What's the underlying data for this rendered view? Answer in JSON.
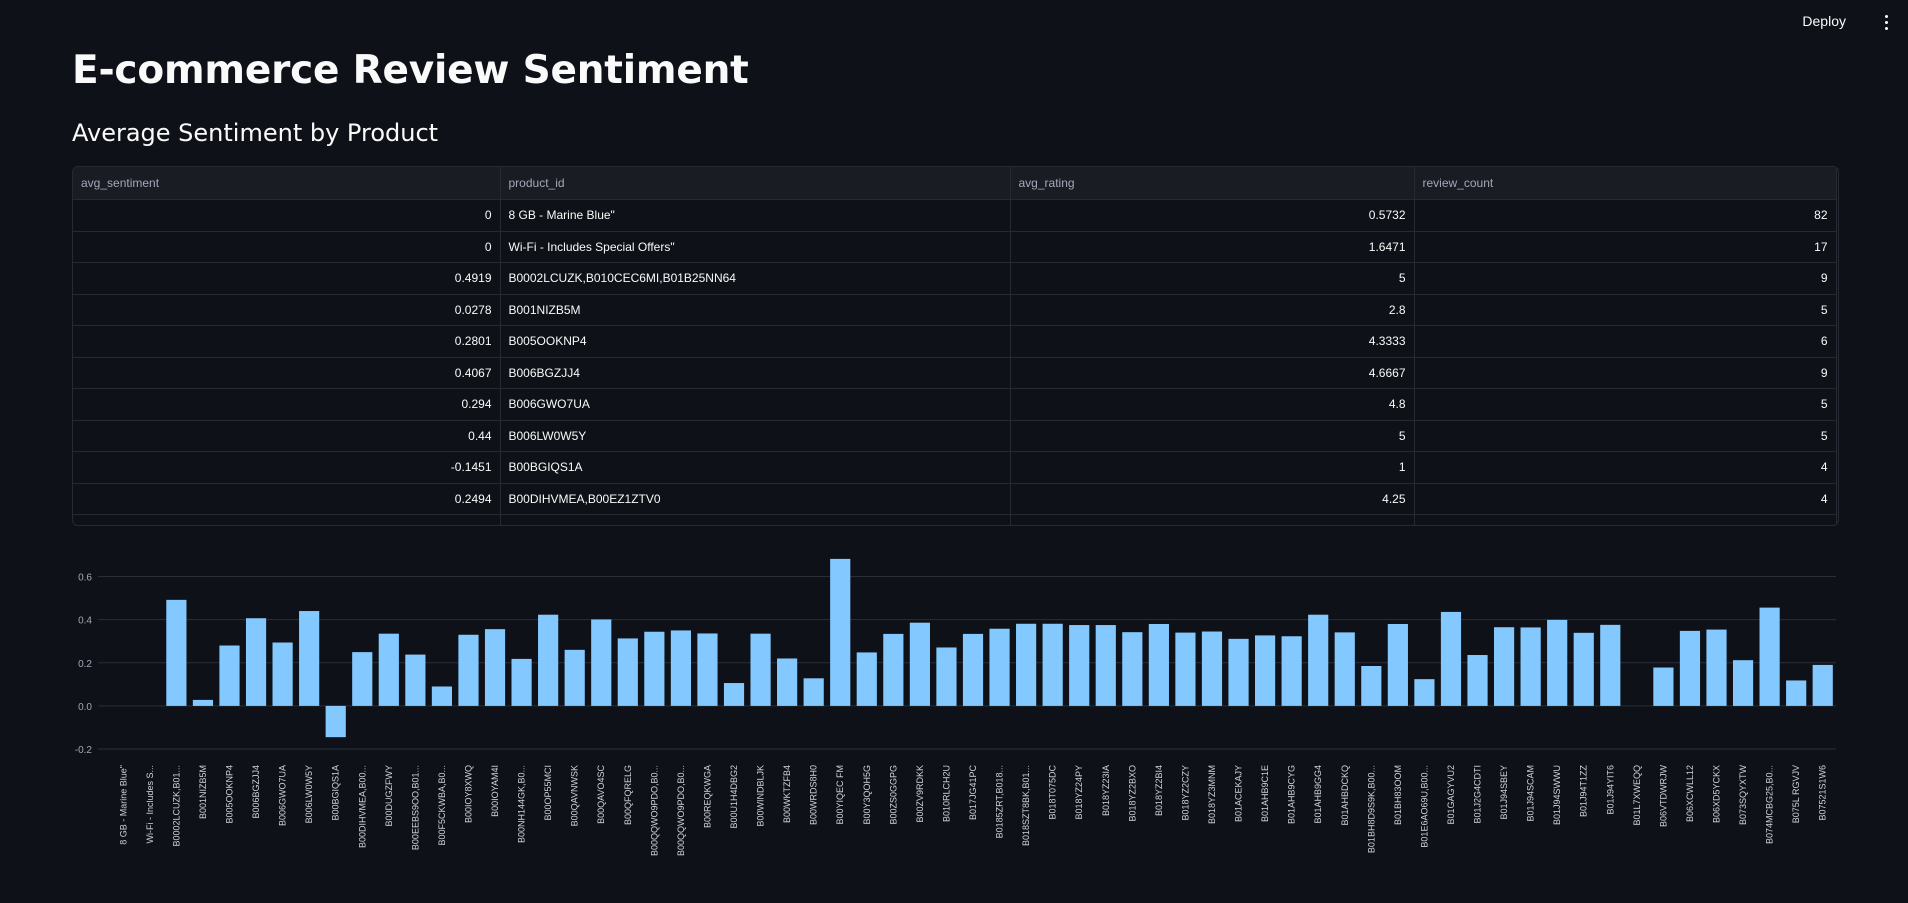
{
  "header": {
    "deploy_label": "Deploy"
  },
  "page": {
    "title": "E-commerce Review Sentiment",
    "section_title": "Average Sentiment by Product"
  },
  "table": {
    "columns": [
      "avg_sentiment",
      "product_id",
      "avg_rating",
      "review_count"
    ],
    "rows": [
      [
        "0",
        " 8 GB - Marine Blue\"",
        "0.5732",
        "82"
      ],
      [
        "0",
        " Wi-Fi - Includes Special Offers\"",
        "1.6471",
        "17"
      ],
      [
        "0.4919",
        "B0002LCUZK,B010CEC6MI,B01B25NN64",
        "5",
        "9"
      ],
      [
        "0.0278",
        "B001NIZB5M",
        "2.8",
        "5"
      ],
      [
        "0.2801",
        "B005OOKNP4",
        "4.3333",
        "6"
      ],
      [
        "0.4067",
        "B006BGZJJ4",
        "4.6667",
        "9"
      ],
      [
        "0.294",
        "B006GWO7UA",
        "4.8",
        "5"
      ],
      [
        "0.44",
        "B006LW0W5Y",
        "5",
        "5"
      ],
      [
        "-0.1451",
        "B00BGIQS1A",
        "1",
        "4"
      ],
      [
        "0.2494",
        "B00DIHVMEA,B00EZ1ZTV0",
        "4.25",
        "4"
      ]
    ]
  },
  "colors": {
    "bar": "#83c9ff",
    "grid": "#2a2e38",
    "axis_text": "#a3a8b8"
  },
  "chart_data": {
    "type": "bar",
    "ylim": [
      -0.2,
      0.7
    ],
    "yticks": [
      -0.2,
      0.0,
      0.2,
      0.4,
      0.6
    ],
    "grid": true,
    "xlabel": "",
    "ylabel": "",
    "categories": [
      "8 GB - Marine Blue\"",
      "Wi-Fi - Includes S...",
      "B0002LCUZK,B01...",
      "B001NIZB5M",
      "B005OOKNP4",
      "B006BGZJJ4",
      "B006GWO7UA",
      "B006LW0W5Y",
      "B00BGIQS1A",
      "B00DIHVMEA,B00...",
      "B00DUGZFWY",
      "B00EEBS9OO,B01...",
      "B00F5CKWBA,B0...",
      "B00IOY8XWQ",
      "B00IOYAM4I",
      "B00NH144GK,B0...",
      "B00OP55MCI",
      "B00QAVNWSK",
      "B00QAVO4SC",
      "B00QFQRELG",
      "B00QQWO9PDO,B0...",
      "B00QQWO9PDO,B0...",
      "B00REQKWGA",
      "B00U1H4DBG2",
      "B00WINDBLJK",
      "B00WKTZFB4",
      "B00WRDS8H0",
      "B00YIQEC FM",
      "B00Y3QOH5G",
      "B00ZS0GGPG",
      "B00ZV9RDKK",
      "B010RLCH2U",
      "B017JG41PC",
      "B0185ZRT,B018...",
      "B018SZT8BK,B01...",
      "B018T075DC",
      "B018YZ24PY",
      "B018YZ23IA",
      "B018YZ2BXO",
      "B018YZ2BI4",
      "B018YZ2CZY",
      "B018YZ3MNM",
      "B01ACEKAJY",
      "B01AHB9C1E",
      "B01AHB9CYG",
      "B01AHB9GG4",
      "B01AHBDCKQ",
      "B01BH8D9S9K,B00...",
      "B01BH83OOM",
      "B01E6AO69U,B00...",
      "B01GAGYVU2",
      "B01J2G4CDTI",
      "B01J94SBEY",
      "B01J94SCAM",
      "B01J94SWWU",
      "B01J94T1ZZ",
      "B01J94YIT6",
      "B01L7XWEQQ",
      "B06VTDWRJW",
      "B06XCWLL12",
      "B06XD5YCKX",
      "B073SQYXTW",
      "B074MCBG25,B0...",
      "B075L RGVJV",
      "B07521S1W6"
    ],
    "values": [
      0.0,
      0.0,
      0.4919,
      0.0278,
      0.2801,
      0.4067,
      0.294,
      0.44,
      -0.1451,
      0.2494,
      0.335,
      0.238,
      0.09,
      0.33,
      0.356,
      0.218,
      0.423,
      0.26,
      0.401,
      0.313,
      0.344,
      0.35,
      0.336,
      0.106,
      0.335,
      0.22,
      0.128,
      0.682,
      0.248,
      0.334,
      0.386,
      0.271,
      0.334,
      0.358,
      0.381,
      0.381,
      0.375,
      0.375,
      0.342,
      0.38,
      0.34,
      0.345,
      0.311,
      0.327,
      0.323,
      0.423,
      0.341,
      0.185,
      0.38,
      0.124,
      0.436,
      0.236,
      0.365,
      0.364,
      0.399,
      0.339,
      0.376,
      0.0,
      0.178,
      0.348,
      0.354,
      0.212,
      0.456,
      0.118,
      0.19
    ]
  }
}
